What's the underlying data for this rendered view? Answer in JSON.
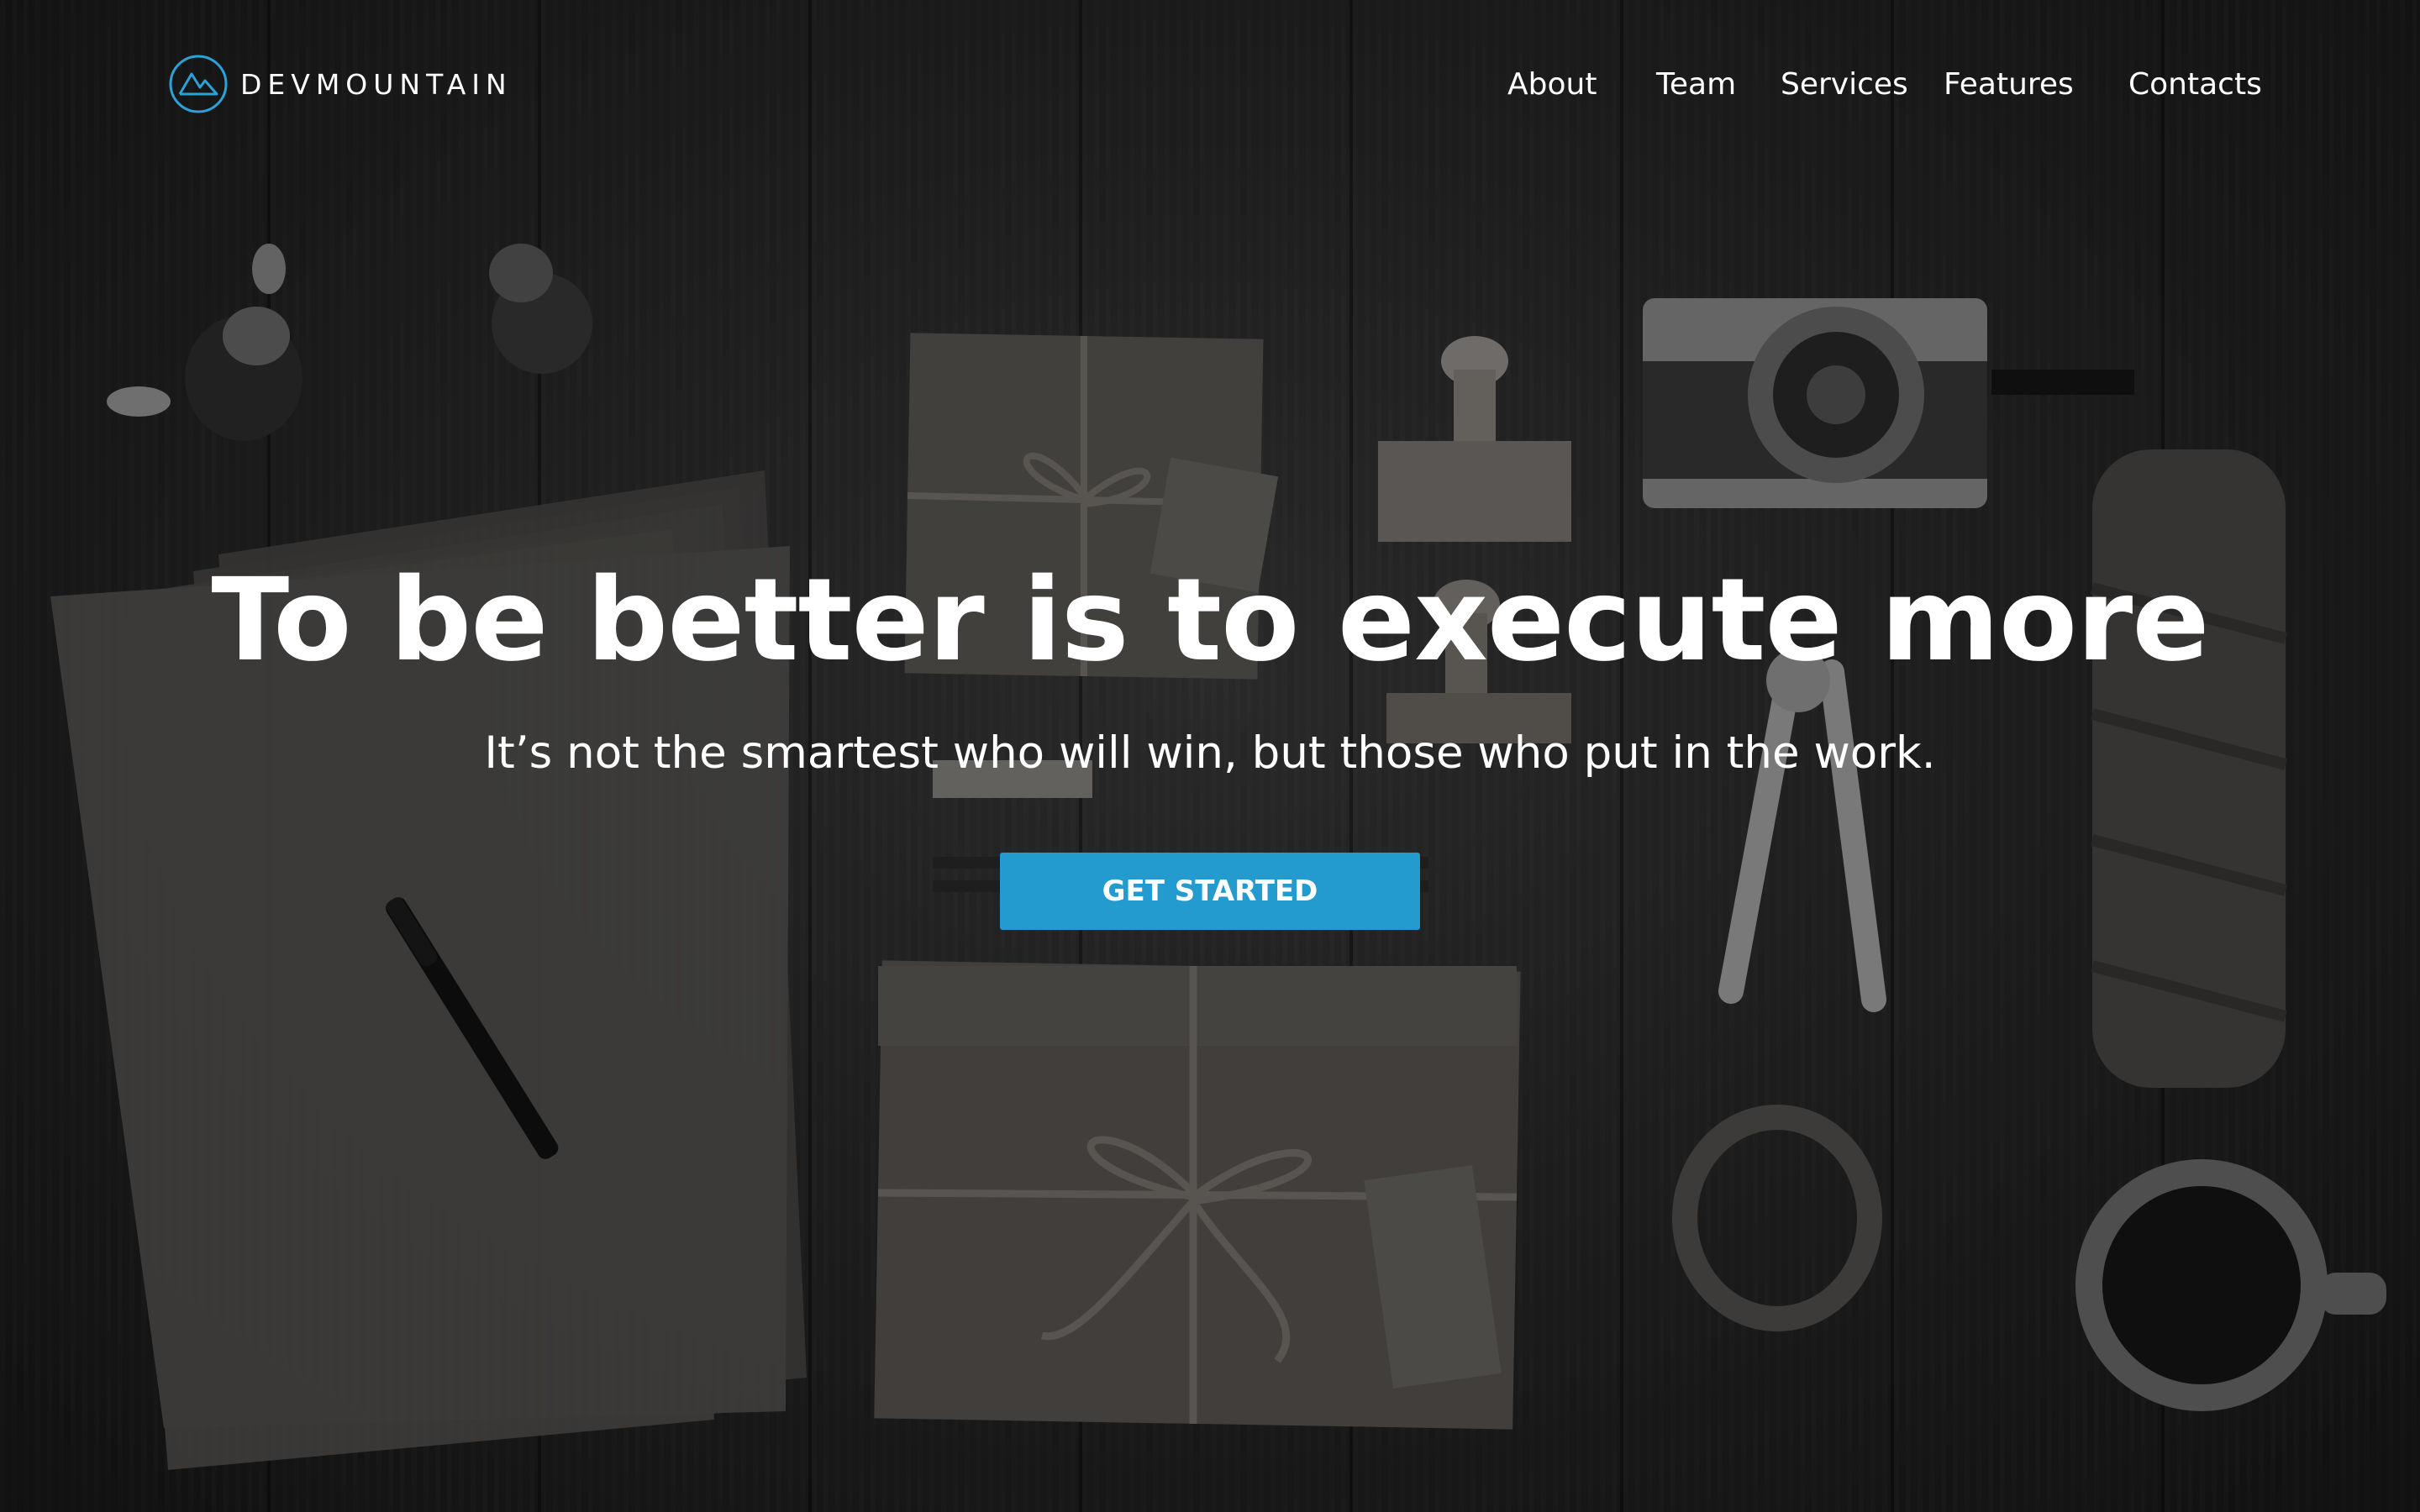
{
  "brand": {
    "name": "DEVMOUNTAIN",
    "logo_icon": "mountain-circle-icon",
    "accent_color": "#2aa2d6"
  },
  "nav": {
    "items": [
      {
        "label": "About"
      },
      {
        "label": "Team"
      },
      {
        "label": "Services"
      },
      {
        "label": "Features"
      },
      {
        "label": "Contacts"
      }
    ]
  },
  "hero": {
    "headline": "To be better is to execute more",
    "subheadline": "It’s not the smartest who will win, but those who put in the work.",
    "cta_label": "GET STARTED",
    "cta_color": "#239bcf",
    "background": "dark desk flat-lay photo"
  }
}
